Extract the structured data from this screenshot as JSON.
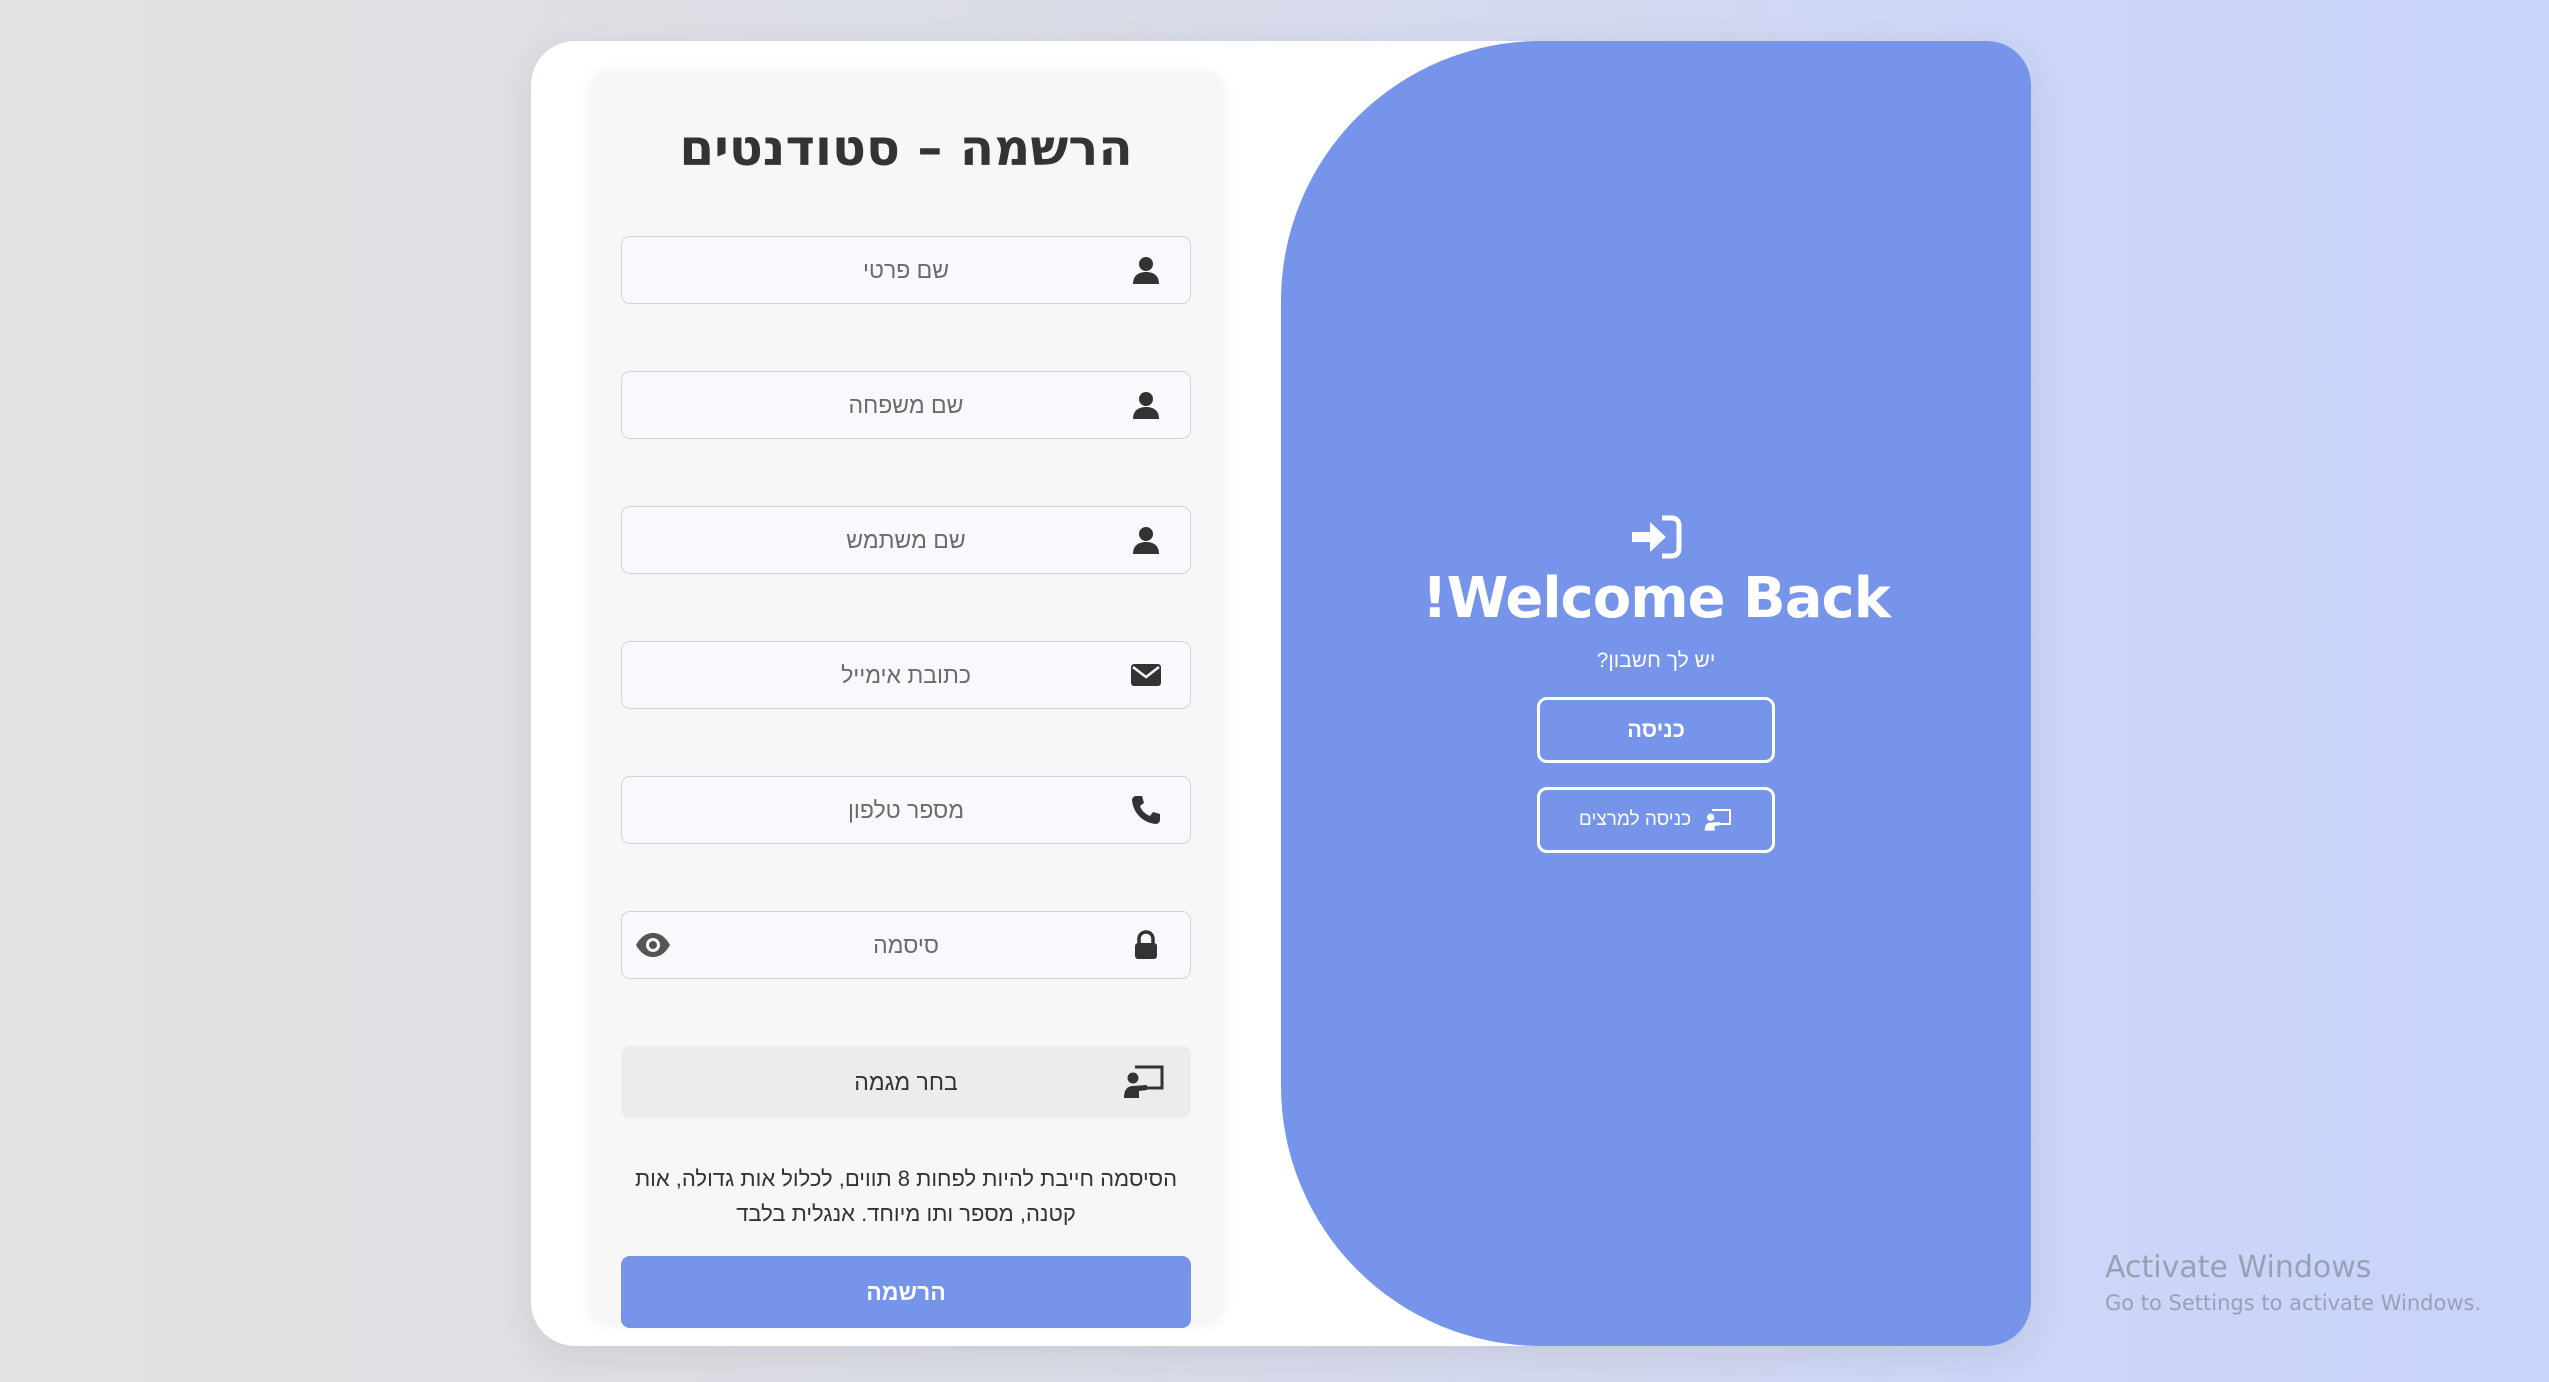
{
  "form": {
    "title": "הרשמה – סטודנטים",
    "fields": [
      {
        "placeholder": "שם פרטי",
        "icon": "user-icon"
      },
      {
        "placeholder": "שם משפחה",
        "icon": "user-icon"
      },
      {
        "placeholder": "שם משתמש",
        "icon": "user-icon"
      },
      {
        "placeholder": "כתובת אימייל",
        "icon": "envelope-icon"
      },
      {
        "placeholder": "מספר טלפון",
        "icon": "phone-icon"
      },
      {
        "placeholder": "סיסמה",
        "icon": "lock-icon"
      }
    ],
    "track_select": {
      "label": "בחר מגמה",
      "icon": "teacher-board-icon"
    },
    "password_hint": "הסיסמה חייבת להיות לפחות 8 תווים, לכלול אות גדולה, אות קטנה, מספר ותו מיוחד. אנגלית בלבד",
    "submit_label": "הרשמה"
  },
  "panel": {
    "icon": "sign-in-icon",
    "heading": "Welcome Back!",
    "subtext": "יש לך חשבון?",
    "login_label": "כניסה",
    "lecturer_login_label": "כניסה למרצים",
    "color": "#7594ea"
  },
  "watermark": {
    "title": "Activate Windows",
    "subtitle": "Go to Settings to activate Windows."
  }
}
